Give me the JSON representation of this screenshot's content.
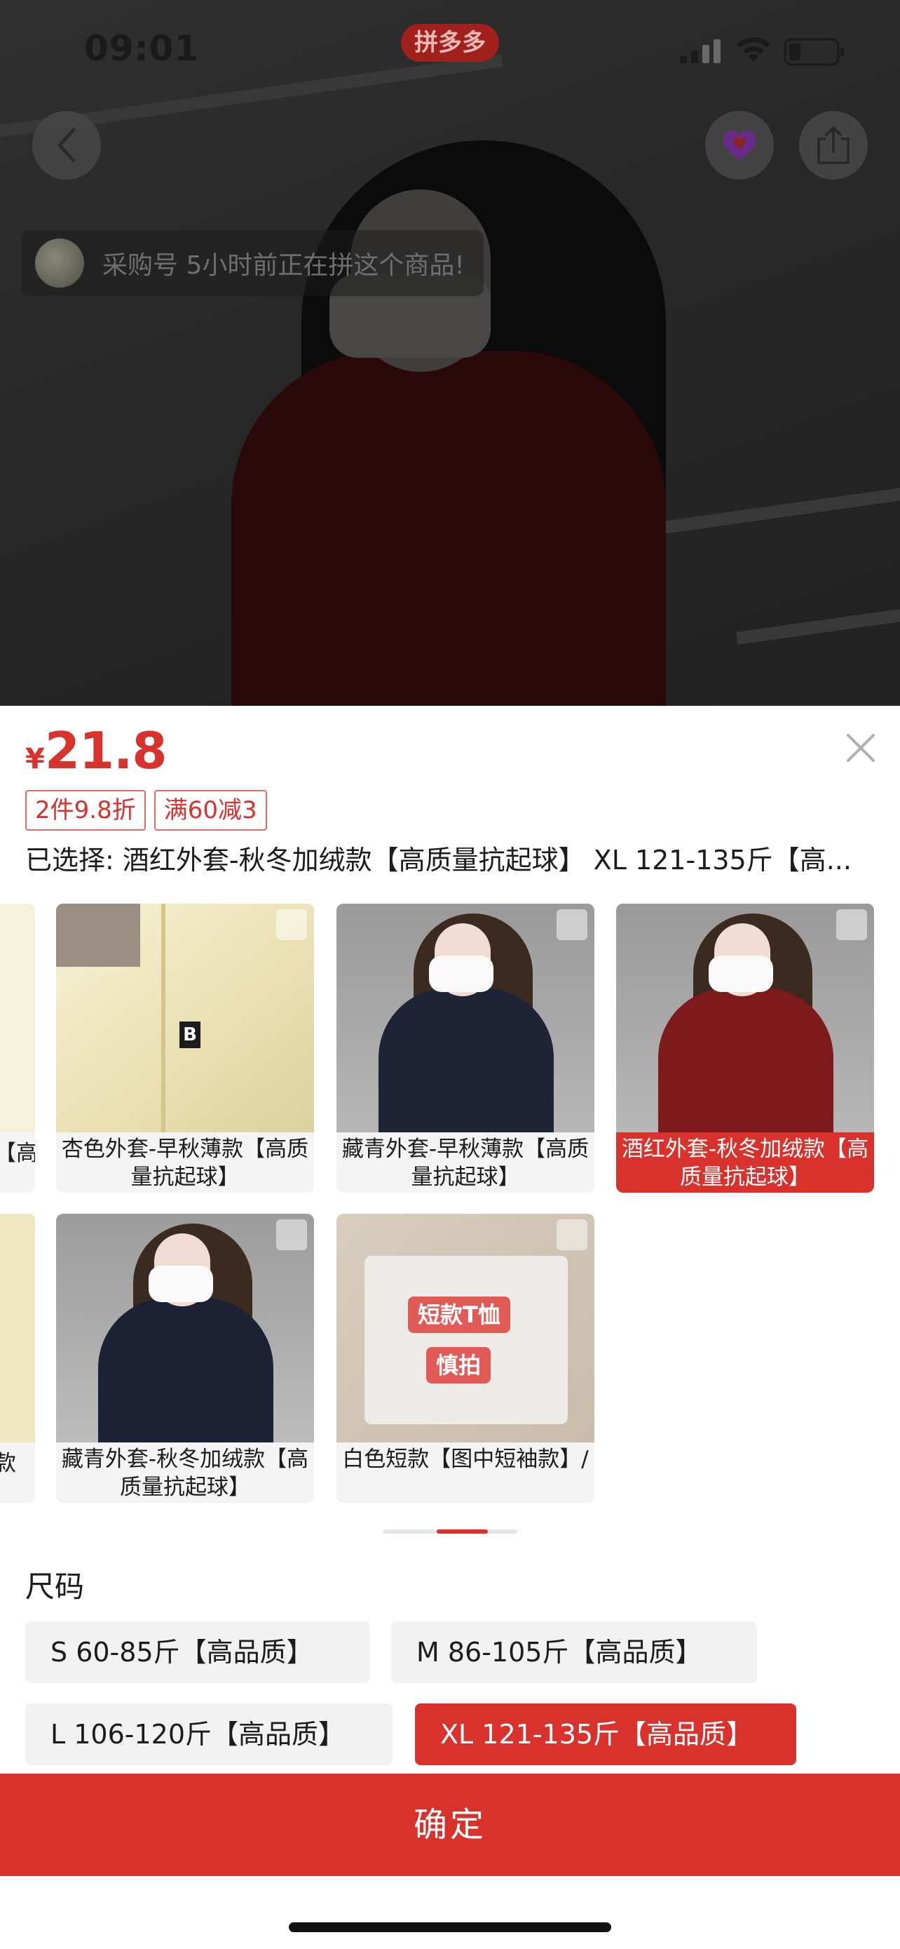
{
  "status_bar": {
    "time": "09:01",
    "app_badge": "拼多多"
  },
  "hero": {
    "toast_text": "采购号 5小时前正在拼这个商品!",
    "dimmed": true
  },
  "sheet": {
    "price": {
      "currency": "¥",
      "amount": "21.8"
    },
    "promo_tags": [
      "2件9.8折",
      "满60减3"
    ],
    "selected_text": "已选择: 酒红外套-秋冬加绒款【高质量抗起球】 XL 121-135斤【高...",
    "variants_row1": [
      {
        "label": "【高",
        "partial": true
      },
      {
        "label": "杏色外套-早秋薄款【高质量抗起球】",
        "coat_color": "#f3ecc8",
        "selected": false
      },
      {
        "label": "藏青外套-早秋薄款【高质量抗起球】",
        "coat_color": "#1e2436",
        "selected": false
      },
      {
        "label": "酒红外套-秋冬加绒款【高质量抗起球】",
        "coat_color": "#7c1a1c",
        "selected": true
      }
    ],
    "variants_row2": [
      {
        "label": "款",
        "partial": true
      },
      {
        "label": "藏青外套-秋冬加绒款【高质量抗起球】",
        "coat_color": "#1c2133",
        "selected": false
      },
      {
        "label": "白色短款【图中短袖款】/",
        "selected": false,
        "badges": [
          "短款T恤",
          "慎拍"
        ]
      }
    ],
    "scroll_position": 0.65,
    "size_title": "尺码",
    "sizes": [
      {
        "label": "S 60-85斤【高品质】",
        "selected": false
      },
      {
        "label": "M 86-105斤【高品质】",
        "selected": false
      },
      {
        "label": "L 106-120斤【高品质】",
        "selected": false
      },
      {
        "label": "XL 121-135斤【高品质】",
        "selected": true
      }
    ],
    "confirm_label": "确定"
  },
  "colors": {
    "accent": "#d9312b",
    "chip_bg": "#f2f2f2"
  }
}
